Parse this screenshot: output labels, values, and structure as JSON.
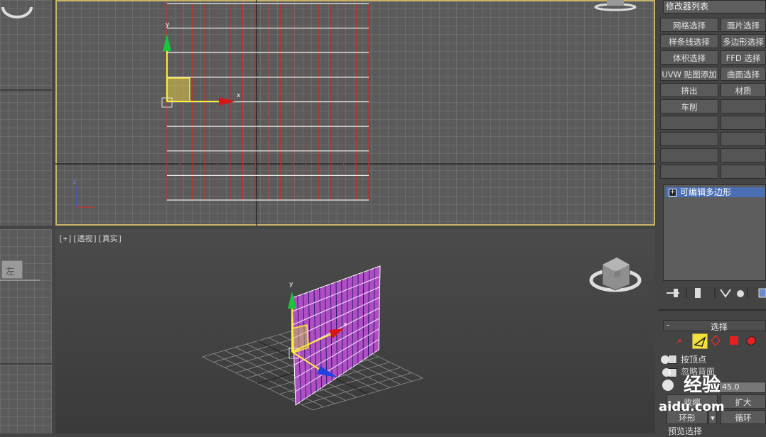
{
  "viewports": {
    "perspective_label": "[+][透视][真实]"
  },
  "axis_labels": {
    "x": "x",
    "y": "y",
    "z": "z"
  },
  "viewcube": {
    "left_label": "左",
    "persp_face": "前"
  },
  "panel": {
    "modifier_list": "修改器列表",
    "buttons": [
      "网格选择",
      "面片选择",
      "样条线选择",
      "多边形选择",
      "体积选择",
      "FFD 选择",
      "UVW 贴图添加",
      "曲面选择",
      "挤出",
      "材质",
      "车削",
      ""
    ],
    "stack_item": "可编辑多边形",
    "stack_plus": "+",
    "rollout_minus": "-",
    "rollout_title": "选择",
    "by_vertex": "按顶点",
    "ignore_backface": "忽略背面",
    "threshold_value": "45.0",
    "shrink": "收缩",
    "grow": "扩大",
    "ring": "环形",
    "loop": "循环",
    "preview_selection": "预览选择"
  },
  "colors": {
    "accent_selection": "#ffff00",
    "mesh_magenta": "#b04fc4",
    "grid_red": "#c0302c",
    "viewport_border": "#c8b56a"
  },
  "watermark": {
    "line1": "经验",
    "line2": "aidu.com"
  }
}
